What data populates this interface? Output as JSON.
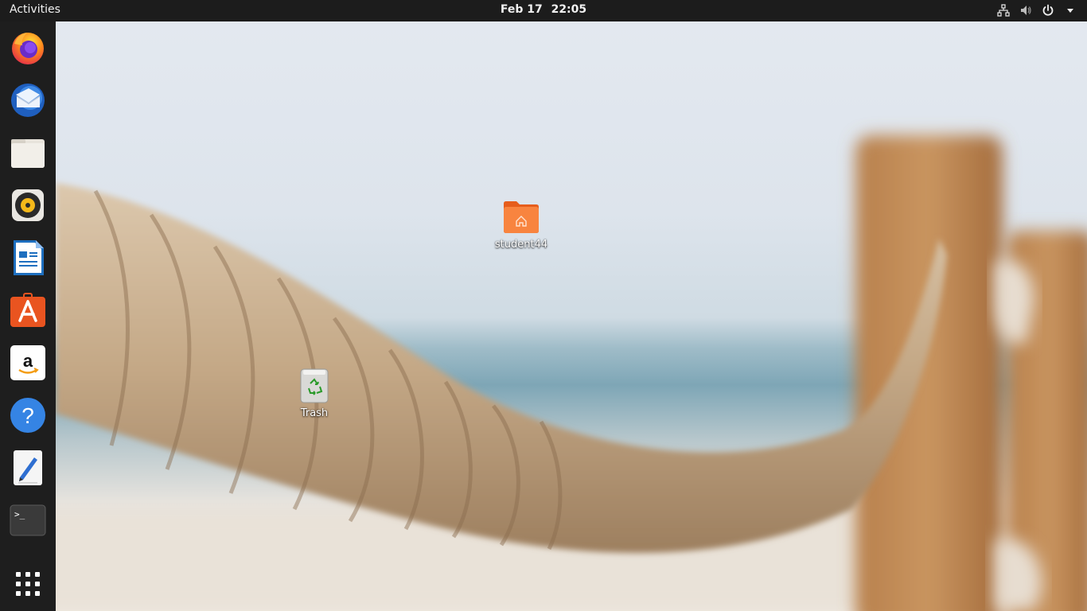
{
  "topbar": {
    "activities_label": "Activities",
    "date": "Feb 17",
    "time": "22:05",
    "tray_icons": [
      "network-icon",
      "volume-icon",
      "power-icon",
      "menu-arrow-icon"
    ]
  },
  "dock": {
    "apps": [
      {
        "name": "firefox",
        "icon": "firefox-icon"
      },
      {
        "name": "thunderbird",
        "icon": "thunderbird-icon"
      },
      {
        "name": "files",
        "icon": "files-icon"
      },
      {
        "name": "rhythmbox",
        "icon": "rhythmbox-icon"
      },
      {
        "name": "libreoffice-writer",
        "icon": "writer-icon"
      },
      {
        "name": "ubuntu-software",
        "icon": "software-icon"
      },
      {
        "name": "amazon",
        "icon": "amazon-icon"
      },
      {
        "name": "help",
        "icon": "help-icon"
      },
      {
        "name": "text-editor",
        "icon": "text-editor-icon"
      },
      {
        "name": "terminal",
        "icon": "terminal-icon"
      }
    ],
    "show_apps_icon": "app-grid-icon"
  },
  "desktop": {
    "home_folder_label": "student44",
    "trash_label": "Trash"
  },
  "colors": {
    "topbar_bg": "#1c1c1c",
    "dock_bg": "#1e1e1e",
    "folder_orange": "#f47a3c"
  }
}
